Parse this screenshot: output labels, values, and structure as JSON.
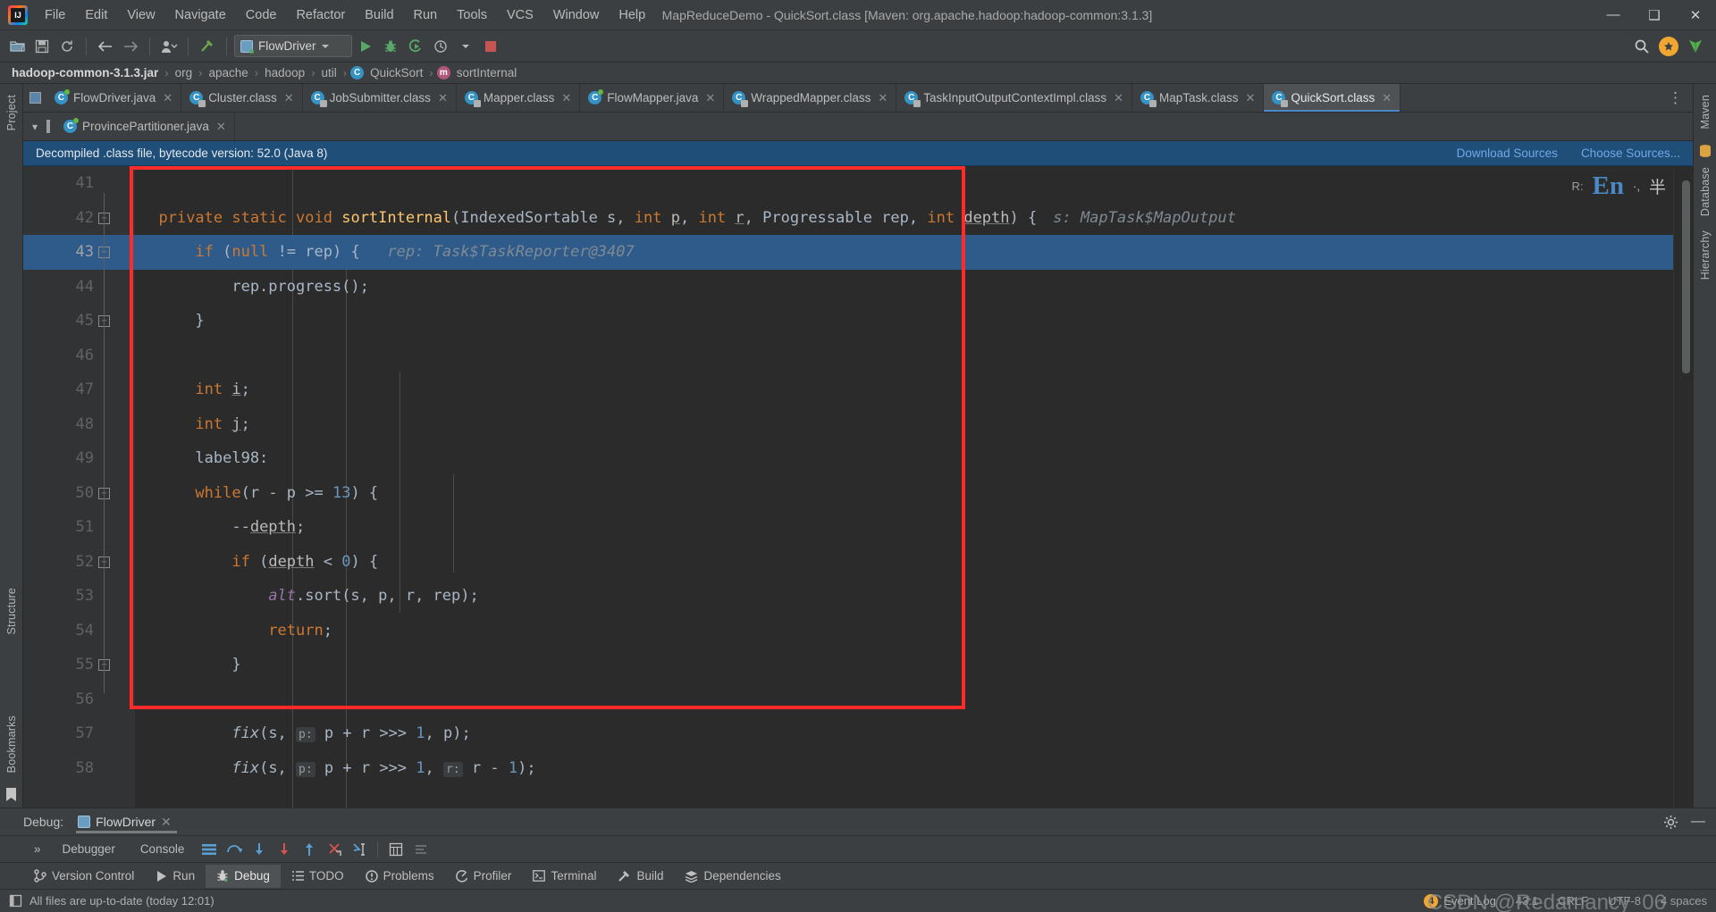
{
  "window": {
    "title": "MapReduceDemo - QuickSort.class [Maven: org.apache.hadoop:hadoop-common:3.1.3]",
    "minimize": "—",
    "maximize": "❑",
    "close": "✕"
  },
  "menu": [
    "File",
    "Edit",
    "View",
    "Navigate",
    "Code",
    "Refactor",
    "Build",
    "Run",
    "Tools",
    "VCS",
    "Window",
    "Help"
  ],
  "toolbar": {
    "run_config": "FlowDriver",
    "icons": [
      "open-folder-icon",
      "save-all-icon",
      "sync-icon",
      "back-arrow-icon",
      "forward-arrow-icon",
      "profile-icon",
      "build-hammer-icon",
      "run-icon",
      "debug-icon",
      "run-coverage-icon",
      "profiler-icon",
      "stop-icon"
    ],
    "search_icon": "search-icon"
  },
  "breadcrumb": {
    "items": [
      {
        "label": "hadoop-common-3.1.3.jar",
        "icon": "",
        "bold": true
      },
      {
        "label": "org",
        "icon": ""
      },
      {
        "label": "apache",
        "icon": ""
      },
      {
        "label": "hadoop",
        "icon": ""
      },
      {
        "label": "util",
        "icon": ""
      },
      {
        "label": "QuickSort",
        "icon": "class-icon"
      },
      {
        "label": "sortInternal",
        "icon": "method-icon"
      }
    ],
    "separator": "›"
  },
  "left_tool_tabs": [
    "Project",
    "Structure",
    "Bookmarks"
  ],
  "right_tool_tabs": [
    "Maven",
    "Database",
    "Hierarchy"
  ],
  "editor_tabs_row1": [
    {
      "label": "FlowDriver.java",
      "kind": "java",
      "active": false
    },
    {
      "label": "Cluster.class",
      "kind": "class",
      "active": false
    },
    {
      "label": "JobSubmitter.class",
      "kind": "class",
      "active": false
    },
    {
      "label": "Mapper.class",
      "kind": "class",
      "active": false
    },
    {
      "label": "FlowMapper.java",
      "kind": "java",
      "active": false
    },
    {
      "label": "WrappedMapper.class",
      "kind": "class",
      "active": false
    },
    {
      "label": "TaskInputOutputContextImpl.class",
      "kind": "class",
      "active": false
    },
    {
      "label": "MapTask.class",
      "kind": "class",
      "active": false
    },
    {
      "label": "QuickSort.class",
      "kind": "class",
      "active": true
    }
  ],
  "editor_tabs_row2": [
    {
      "label": "ProvincePartitioner.java",
      "kind": "java",
      "active": false
    }
  ],
  "tabs_more": "⋮",
  "close_glyph": "✕",
  "notification": {
    "message": "Decompiled .class file, bytecode version: 52.0 (Java 8)",
    "link1": "Download Sources",
    "link2": "Choose Sources..."
  },
  "editor": {
    "line_numbers": [
      "41",
      "42",
      "43",
      "44",
      "45",
      "46",
      "47",
      "48",
      "49",
      "50",
      "51",
      "52",
      "53",
      "54",
      "55",
      "56",
      "57",
      "58"
    ],
    "current_line": "43",
    "highlight_line": "43",
    "inline_hint_right": "s: MapTask$MapOutput",
    "lines": [
      {
        "n": "41",
        "segs": []
      },
      {
        "n": "42",
        "segs": [
          {
            "t": "  ",
            "c": "txt"
          },
          {
            "t": "private ",
            "c": "kw"
          },
          {
            "t": "static ",
            "c": "kw"
          },
          {
            "t": "void ",
            "c": "kw"
          },
          {
            "t": "sortInternal",
            "c": "fnname"
          },
          {
            "t": "(",
            "c": "txt"
          },
          {
            "t": "IndexedSortable s, ",
            "c": "txt"
          },
          {
            "t": "int ",
            "c": "kw"
          },
          {
            "t": "p",
            "c": "undl"
          },
          {
            "t": ", ",
            "c": "txt"
          },
          {
            "t": "int ",
            "c": "kw"
          },
          {
            "t": "r",
            "c": "undl"
          },
          {
            "t": ", ",
            "c": "txt"
          },
          {
            "t": "Progressable rep, ",
            "c": "txt"
          },
          {
            "t": "int ",
            "c": "kw"
          },
          {
            "t": "depth",
            "c": "undl"
          },
          {
            "t": ") {",
            "c": "txt"
          }
        ]
      },
      {
        "n": "43",
        "segs": [
          {
            "t": "      ",
            "c": "txt"
          },
          {
            "t": "if ",
            "c": "kw"
          },
          {
            "t": "(",
            "c": "txt"
          },
          {
            "t": "null ",
            "c": "kw"
          },
          {
            "t": "!= rep) {",
            "c": "txt"
          },
          {
            "t": "   rep: Task$TaskReporter@3407",
            "c": "hint"
          }
        ]
      },
      {
        "n": "44",
        "segs": [
          {
            "t": "          rep.progress();",
            "c": "txt"
          }
        ]
      },
      {
        "n": "45",
        "segs": [
          {
            "t": "      }",
            "c": "txt"
          }
        ]
      },
      {
        "n": "46",
        "segs": []
      },
      {
        "n": "47",
        "segs": [
          {
            "t": "      ",
            "c": "txt"
          },
          {
            "t": "int ",
            "c": "kw"
          },
          {
            "t": "i",
            "c": "undl"
          },
          {
            "t": ";",
            "c": "txt"
          }
        ]
      },
      {
        "n": "48",
        "segs": [
          {
            "t": "      ",
            "c": "txt"
          },
          {
            "t": "int ",
            "c": "kw"
          },
          {
            "t": "j",
            "c": "undl"
          },
          {
            "t": ";",
            "c": "txt"
          }
        ]
      },
      {
        "n": "49",
        "segs": [
          {
            "t": "      label98:",
            "c": "txt"
          }
        ]
      },
      {
        "n": "50",
        "segs": [
          {
            "t": "      ",
            "c": "txt"
          },
          {
            "t": "while",
            "c": "kw"
          },
          {
            "t": "(r - p >= ",
            "c": "txt"
          },
          {
            "t": "13",
            "c": "num"
          },
          {
            "t": ") {",
            "c": "txt"
          }
        ]
      },
      {
        "n": "51",
        "segs": [
          {
            "t": "          --",
            "c": "txt"
          },
          {
            "t": "depth",
            "c": "undl"
          },
          {
            "t": ";",
            "c": "txt"
          }
        ]
      },
      {
        "n": "52",
        "segs": [
          {
            "t": "          ",
            "c": "txt"
          },
          {
            "t": "if ",
            "c": "kw"
          },
          {
            "t": "(",
            "c": "txt"
          },
          {
            "t": "depth",
            "c": "undl"
          },
          {
            "t": " < ",
            "c": "txt"
          },
          {
            "t": "0",
            "c": "num"
          },
          {
            "t": ") {",
            "c": "txt"
          }
        ]
      },
      {
        "n": "53",
        "segs": [
          {
            "t": "              ",
            "c": "txt"
          },
          {
            "t": "alt",
            "c": "fld"
          },
          {
            "t": ".sort(s, p, r, rep);",
            "c": "txt"
          }
        ]
      },
      {
        "n": "54",
        "segs": [
          {
            "t": "              ",
            "c": "txt"
          },
          {
            "t": "return",
            "c": "kw"
          },
          {
            "t": ";",
            "c": "txt"
          }
        ]
      },
      {
        "n": "55",
        "segs": [
          {
            "t": "          }",
            "c": "txt"
          }
        ]
      },
      {
        "n": "56",
        "segs": []
      },
      {
        "n": "57",
        "segs": [
          {
            "t": "          ",
            "c": "txt"
          },
          {
            "t": "fix",
            "c": "italfn"
          },
          {
            "t": "(s, ",
            "c": "txt"
          },
          {
            "t": "p:",
            "c": "phint"
          },
          {
            "t": " p + r >>> ",
            "c": "txt"
          },
          {
            "t": "1",
            "c": "num"
          },
          {
            "t": ", p);",
            "c": "txt"
          }
        ]
      },
      {
        "n": "58",
        "segs": [
          {
            "t": "          ",
            "c": "txt"
          },
          {
            "t": "fix",
            "c": "italfn"
          },
          {
            "t": "(s, ",
            "c": "txt"
          },
          {
            "t": "p:",
            "c": "phint"
          },
          {
            "t": " p + r >>> ",
            "c": "txt"
          },
          {
            "t": "1",
            "c": "num"
          },
          {
            "t": ", ",
            "c": "txt"
          },
          {
            "t": "r:",
            "c": "phint"
          },
          {
            "t": " r - ",
            "c": "txt"
          },
          {
            "t": "1",
            "c": "num"
          },
          {
            "t": ");",
            "c": "txt"
          }
        ]
      }
    ],
    "status_float": {
      "label_left": "R:",
      "en_badge": "En",
      "sep": "·,"
    }
  },
  "debug_panel": {
    "title": "Debug:",
    "session_tab": "FlowDriver",
    "close_glyph": "✕",
    "expand_glyph": "»",
    "tabs": [
      "Debugger",
      "Console"
    ],
    "settings_icon": "gear-icon",
    "minimize_icon": "minimize-icon",
    "action_icons": [
      "restore-layout-icon",
      "step-over-icon",
      "step-into-icon",
      "force-step-into-icon",
      "step-out-icon",
      "run-to-cursor-icon",
      "drop-frame-icon",
      "evaluate-icon",
      "mute-breakpoints-icon"
    ]
  },
  "bottom_bar": [
    {
      "label": "Version Control",
      "icon": "branch-icon",
      "active": false
    },
    {
      "label": "Run",
      "icon": "run-icon",
      "active": false
    },
    {
      "label": "Debug",
      "icon": "debug-icon",
      "active": true
    },
    {
      "label": "TODO",
      "icon": "todo-icon",
      "active": false
    },
    {
      "label": "Problems",
      "icon": "problems-icon",
      "active": false
    },
    {
      "label": "Profiler",
      "icon": "profiler-icon",
      "active": false
    },
    {
      "label": "Terminal",
      "icon": "terminal-icon",
      "active": false
    },
    {
      "label": "Build",
      "icon": "build-icon",
      "active": false
    },
    {
      "label": "Dependencies",
      "icon": "dependencies-icon",
      "active": false
    }
  ],
  "status_bar": {
    "message": "All files are up-to-date (today 12:01)",
    "message_icon": "file-icon",
    "event_log": "Event Log",
    "event_count": "4",
    "caret": "43:1",
    "line_sep": "CRLF",
    "encoding": "UTF-8",
    "indent": "4 spaces",
    "watermark": "CSDN @Redamancy_06"
  },
  "colors": {
    "accent_blue": "#4a88c7",
    "notify_bg": "#1f4e79",
    "highlight_line": "#2f5b8a",
    "redbox": "#ff2b2b",
    "panel_bg": "#3c3f41",
    "editor_bg": "#2b2b2b"
  }
}
